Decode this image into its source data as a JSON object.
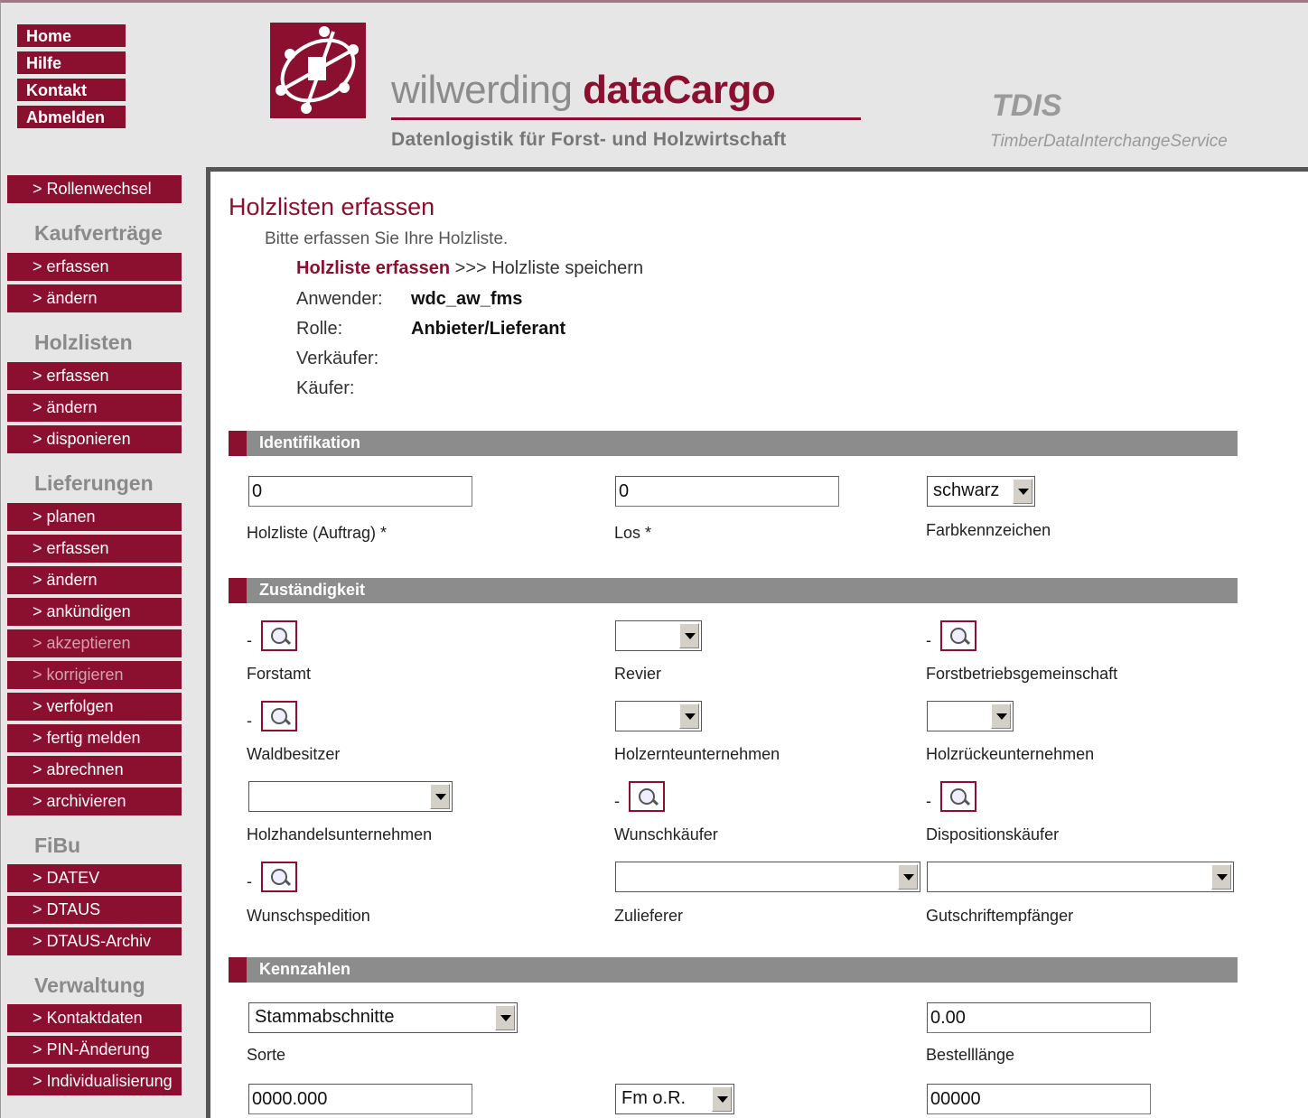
{
  "topnav": [
    "Home",
    "Hilfe",
    "Kontakt",
    "Abmelden"
  ],
  "brand": {
    "name_part1": "wilwerding ",
    "name_part2": "dataCargo",
    "tagline": "Datenlogistik für Forst- und Holzwirtschaft",
    "tdis": "TDIS",
    "tdis_sub": "TimberDataInterchangeService"
  },
  "sidebar": {
    "role_switch": "> Rollenwechsel",
    "kauf_head": "Kaufverträge",
    "kauf_items": [
      "> erfassen",
      "> ändern"
    ],
    "holz_head": "Holzlisten",
    "holz_items": [
      "> erfassen",
      "> ändern",
      "> disponieren"
    ],
    "lief_head": "Lieferungen",
    "lief_items": [
      "> planen",
      "> erfassen",
      "> ändern",
      "> ankündigen",
      "> akzeptieren",
      "> korrigieren",
      "> verfolgen",
      "> fertig melden",
      "> abrechnen",
      "> archivieren"
    ],
    "fibu_head": "FiBu",
    "fibu_items": [
      "> DATEV",
      "> DTAUS",
      "> DTAUS-Archiv"
    ],
    "verw_head": "Verwaltung",
    "verw_items": [
      "> Kontaktdaten",
      "> PIN-Änderung",
      "> Individualisierung"
    ]
  },
  "main": {
    "title": "Holzlisten erfassen",
    "subtitle": "Bitte erfassen Sie Ihre Holzliste.",
    "step_active": "Holzliste erfassen",
    "step_rest": " >>> Holzliste speichern",
    "info": {
      "anwender_label": "Anwender:",
      "anwender_value": "wdc_aw_fms",
      "rolle_label": "Rolle:",
      "rolle_value": "Anbieter/Lieferant",
      "verkaeufer_label": "Verkäufer:",
      "kaeufer_label": "Käufer:"
    }
  },
  "identifikation": {
    "header": "Identifikation",
    "holzliste_value": "0",
    "holzliste_label": "Holzliste (Auftrag)  *",
    "los_value": "0",
    "los_label": "Los  *",
    "farbe_value": "schwarz",
    "farbe_label": "Farbkennzeichen"
  },
  "zustaendigkeit": {
    "header": "Zuständigkeit",
    "forstamt": "Forstamt",
    "revier": "Revier",
    "fbg": "Forstbetriebsgemeinschaft",
    "waldbesitzer": "Waldbesitzer",
    "holzernte": "Holzernteunternehmen",
    "holzrueck": "Holzrückeunternehmen",
    "holzhandel": "Holzhandelsunternehmen",
    "wunschkaeufer": "Wunschkäufer",
    "dispo": "Dispositionskäufer",
    "spedition": "Wunschspedition",
    "zulieferer": "Zulieferer",
    "gutschrift": "Gutschriftempfänger",
    "dash": "-"
  },
  "kennzahlen": {
    "header": "Kennzahlen",
    "sorte_value": "Stammabschnitte",
    "sorte_label": "Sorte",
    "bestell_value": "0.00",
    "bestell_label": "Bestelllänge",
    "menge_value": "0000.000",
    "einheit_value": "Fm o.R.",
    "anzahl_value": "00000"
  },
  "colors": {
    "accent": "#8b0f2e",
    "section_bar": "#8c8c8c",
    "background": "#e6e6e6"
  }
}
